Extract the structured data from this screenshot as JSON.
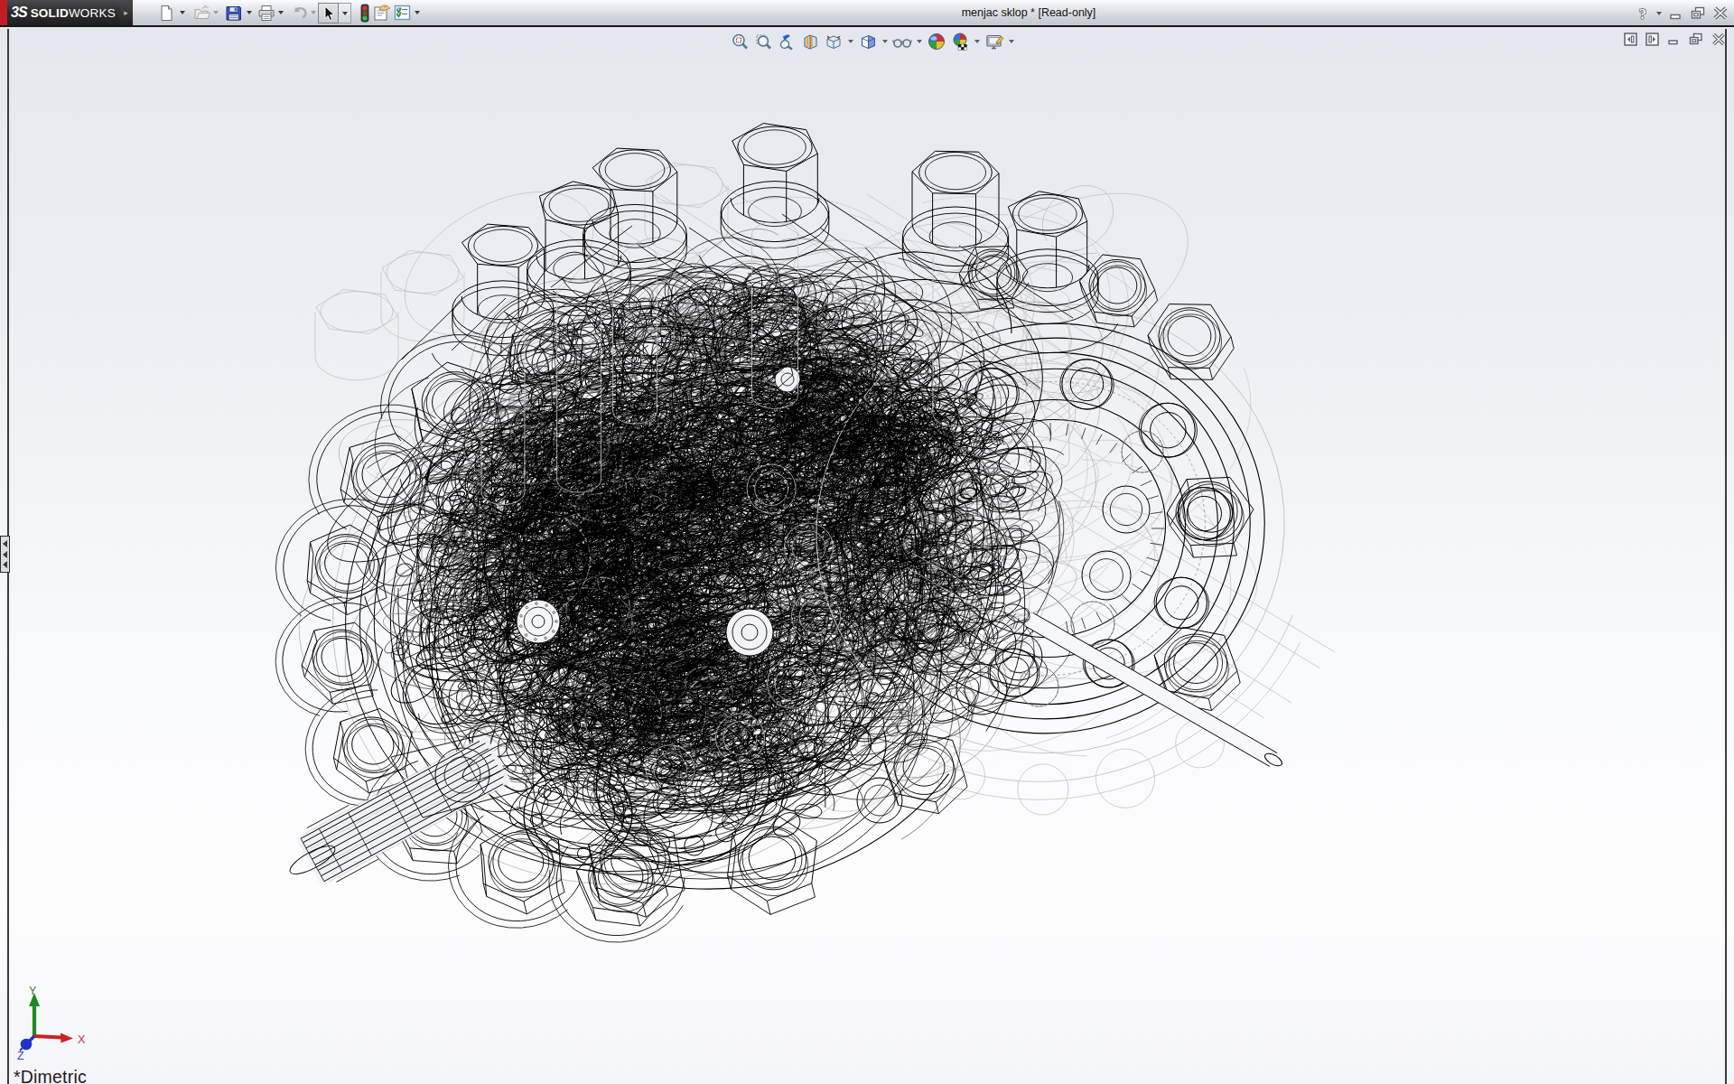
{
  "window": {
    "brand_mark": "3S",
    "brand": "SOLIDWORKS",
    "title": "menjac sklop * [Read-only]",
    "help_label": "?",
    "controls": [
      "minimize",
      "restore",
      "close"
    ]
  },
  "main_toolbar": {
    "items": [
      {
        "name": "new-document",
        "enabled": true,
        "has_dropdown": true
      },
      {
        "name": "open",
        "enabled": false,
        "has_dropdown": true
      },
      {
        "name": "save",
        "enabled": true,
        "has_dropdown": true
      },
      {
        "name": "print",
        "enabled": true,
        "has_dropdown": true
      },
      {
        "name": "undo",
        "enabled": false,
        "has_dropdown": true
      },
      {
        "name": "select",
        "enabled": true,
        "pressed": true,
        "has_dropdown": true
      },
      {
        "name": "interference-detection",
        "enabled": true,
        "has_dropdown": false
      },
      {
        "name": "file-properties",
        "enabled": true,
        "has_dropdown": false
      },
      {
        "name": "options",
        "enabled": true,
        "has_dropdown": true
      }
    ],
    "expand_glyph": "▸"
  },
  "headsup_toolbar": {
    "items": [
      {
        "name": "zoom-to-fit",
        "has_dropdown": false
      },
      {
        "name": "zoom-to-area",
        "has_dropdown": false
      },
      {
        "name": "previous-view",
        "has_dropdown": false
      },
      {
        "name": "section-view",
        "has_dropdown": false
      },
      {
        "name": "view-orientation",
        "has_dropdown": true
      },
      {
        "name": "display-style",
        "has_dropdown": true
      },
      {
        "name": "hide-show-items",
        "has_dropdown": true
      },
      {
        "name": "apply-scene",
        "has_dropdown": false
      },
      {
        "name": "view-settings",
        "has_dropdown": true
      },
      {
        "name": "screen-capture",
        "has_dropdown": true
      }
    ]
  },
  "document_controls": [
    "collapse-left-pane",
    "expand-right-pane",
    "minimize-document",
    "restore-document",
    "close-document"
  ],
  "feature_panel_tab": {
    "collapse_arrows": 3
  },
  "viewport": {
    "orientation_label": "*Dimetric",
    "triad": {
      "x_label": "X",
      "y_label": "Y",
      "z_label": "Z"
    },
    "model_name": "menjac sklop wireframe assembly"
  },
  "colors": {
    "brand_stripe": "#c01e25",
    "titlebar_dark": "#2d2d2f",
    "viewport_top": "#e7e9ef",
    "viewport_bottom": "#fdfdfe",
    "triad_x": "#cc2222",
    "triad_y": "#1f8a1f",
    "triad_z": "#2233cc",
    "wireframe": "#000000",
    "hidden_line": "#c3c3c3"
  }
}
